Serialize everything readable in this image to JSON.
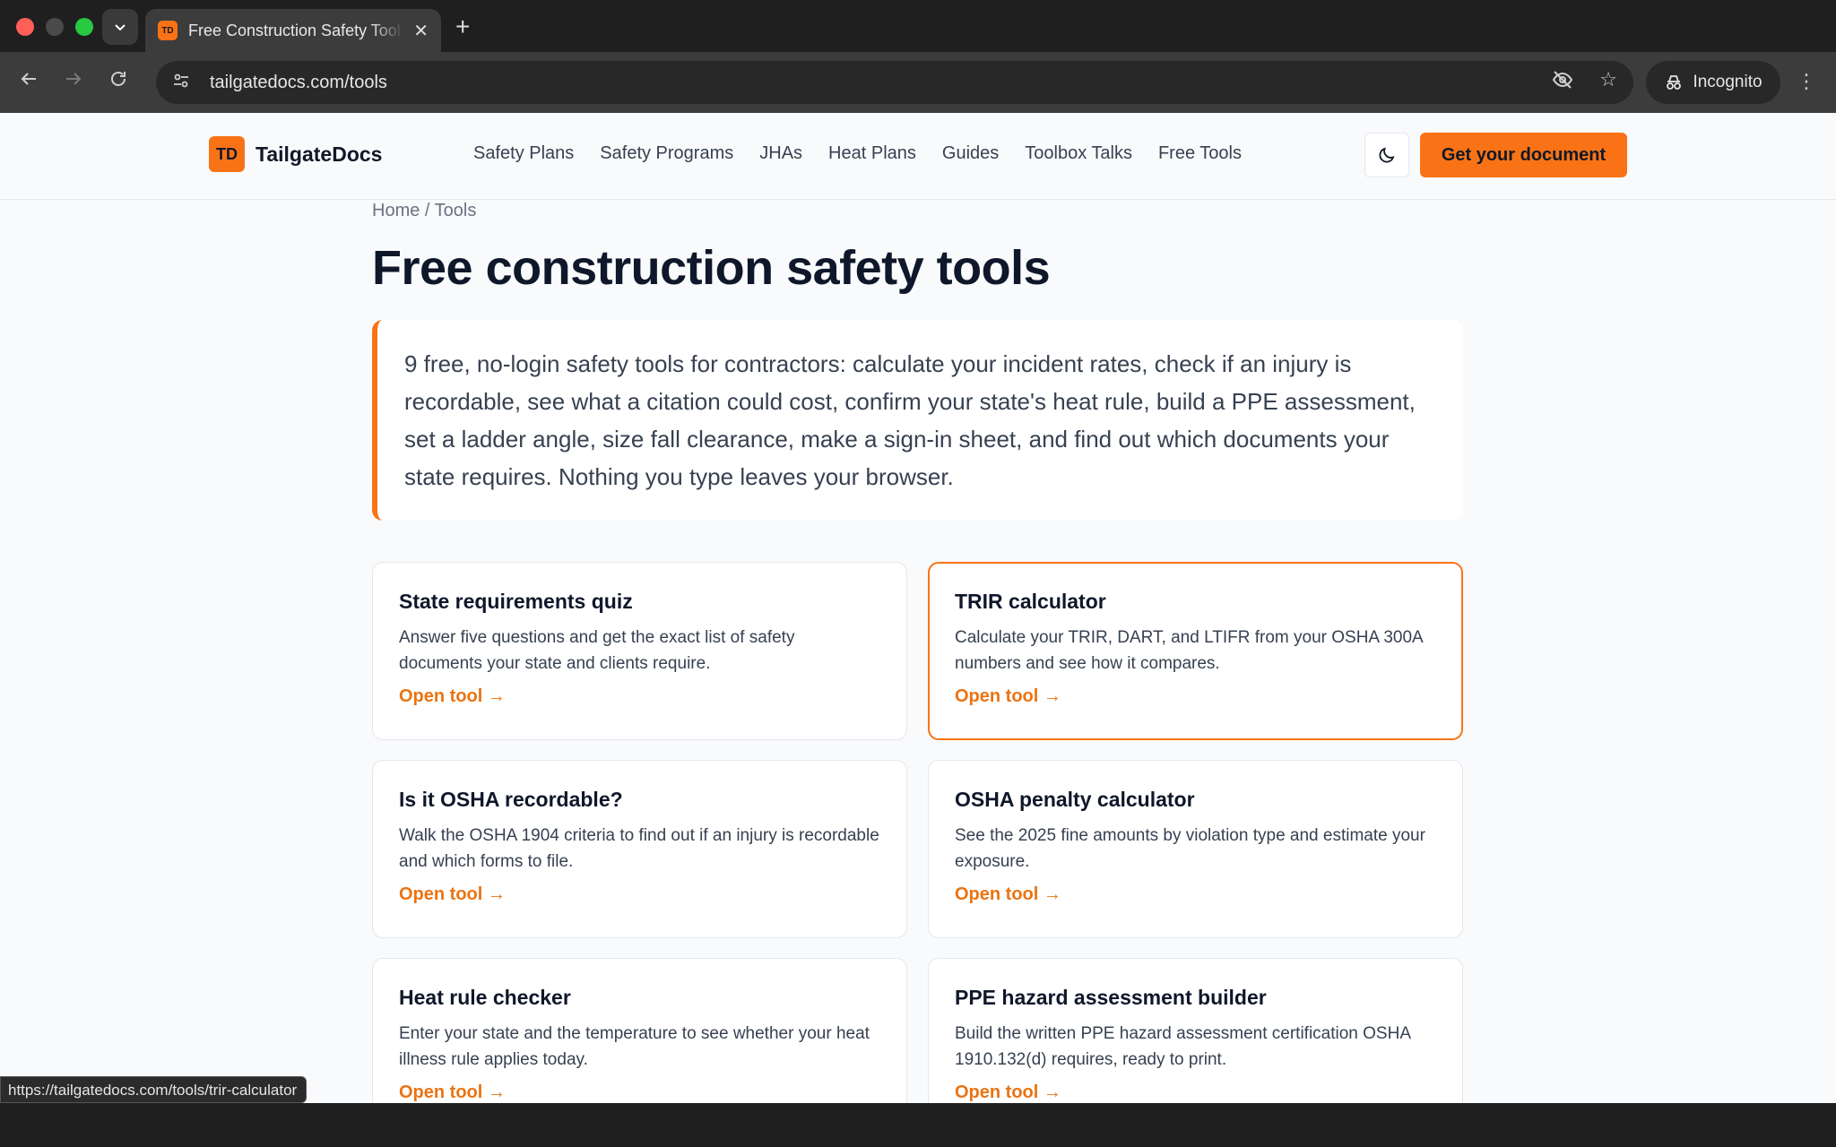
{
  "browser": {
    "tab_title": "Free Construction Safety Tools",
    "tab_favicon": "TD",
    "url": "tailgatedocs.com/tools",
    "incognito_label": "Incognito",
    "status_url": "https://tailgatedocs.com/tools/trir-calculator"
  },
  "header": {
    "logo_mark": "TD",
    "logo_text": "TailgateDocs",
    "nav": [
      "Safety Plans",
      "Safety Programs",
      "JHAs",
      "Heat Plans",
      "Guides",
      "Toolbox Talks",
      "Free Tools"
    ],
    "cta_label": "Get your document"
  },
  "breadcrumb": "Home / Tools",
  "title": "Free construction safety tools",
  "intro": "9 free, no-login safety tools for contractors: calculate your incident rates, check if an injury is recordable, see what a citation could cost, confirm your state's heat rule, build a PPE assessment, set a ladder angle, size fall clearance, make a sign-in sheet, and find out which documents your state requires. Nothing you type leaves your browser.",
  "cards": [
    {
      "title": "State requirements quiz",
      "desc": "Answer five questions and get the exact list of safety documents your state and clients require.",
      "link": "Open tool →"
    },
    {
      "title": "TRIR calculator",
      "desc": "Calculate your TRIR, DART, and LTIFR from your OSHA 300A numbers and see how it compares.",
      "link": "Open tool →"
    },
    {
      "title": "Is it OSHA recordable?",
      "desc": "Walk the OSHA 1904 criteria to find out if an injury is recordable and which forms to file.",
      "link": "Open tool →"
    },
    {
      "title": "OSHA penalty calculator",
      "desc": "See the 2025 fine amounts by violation type and estimate your exposure.",
      "link": "Open tool →"
    },
    {
      "title": "Heat rule checker",
      "desc": "Enter your state and the temperature to see whether your heat illness rule applies today.",
      "link": "Open tool →"
    },
    {
      "title": "PPE hazard assessment builder",
      "desc": "Build the written PPE hazard assessment certification OSHA 1910.132(d) requires, ready to print.",
      "link": "Open tool →"
    }
  ],
  "colors": {
    "accent": "#f97316",
    "text": "#0f172a"
  }
}
